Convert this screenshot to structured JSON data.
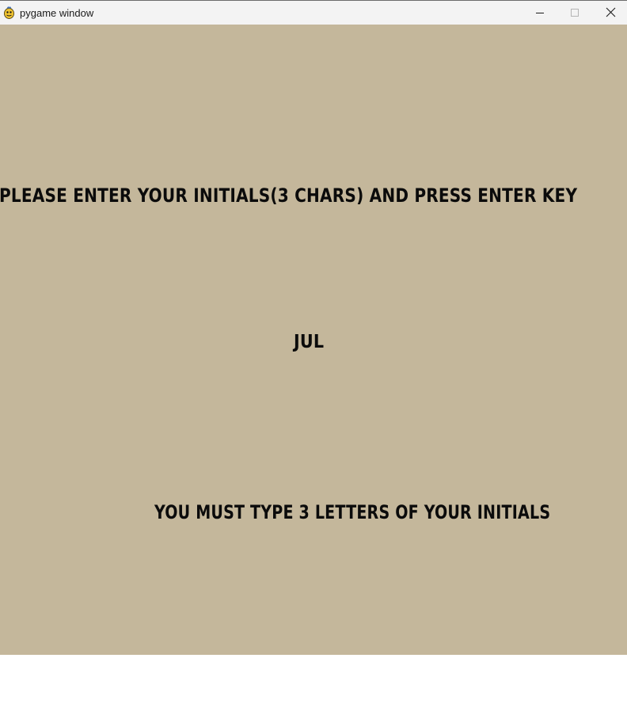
{
  "window": {
    "title": "pygame window",
    "icon": "pygame-snake-icon",
    "controls": {
      "minimize_icon": "minimize-icon",
      "maximize_icon": "maximize-icon",
      "close_icon": "close-icon"
    }
  },
  "game": {
    "background_color": "#c4b79b",
    "text_color": "#0b0b0b",
    "prompt": "PLEASE ENTER YOUR INITIALS(3 CHARS) AND PRESS ENTER KEY",
    "initials": "JUL",
    "error_message": "YOU MUST TYPE 3 LETTERS OF YOUR INITIALS"
  }
}
